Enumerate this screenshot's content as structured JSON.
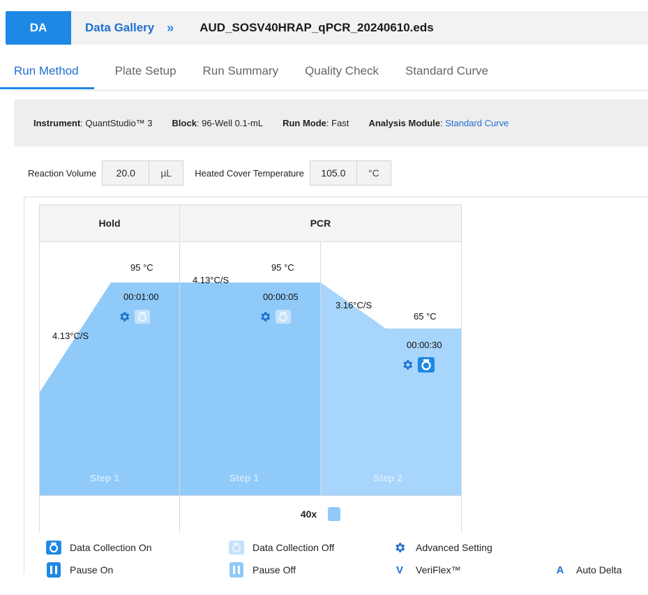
{
  "header": {
    "logo": "DA",
    "breadcrumb_link": "Data Gallery",
    "breadcrumb_sep": "»",
    "file_name": "AUD_SOSV40HRAP_qPCR_20240610.eds"
  },
  "tabs": [
    {
      "label": "Run Method",
      "active": true
    },
    {
      "label": "Plate Setup"
    },
    {
      "label": "Run Summary"
    },
    {
      "label": "Quality Check"
    },
    {
      "label": "Standard Curve"
    }
  ],
  "info": {
    "instrument_label": "Instrument",
    "instrument_value": "QuantStudio™ 3",
    "block_label": "Block",
    "block_value": "96-Well 0.1-mL",
    "run_mode_label": "Run Mode",
    "run_mode_value": "Fast",
    "module_label": "Analysis Module",
    "module_value": "Standard Curve"
  },
  "settings": {
    "reaction_volume_label": "Reaction Volume",
    "reaction_volume_value": "20.0",
    "reaction_volume_unit": "µL",
    "cover_temp_label": "Heated Cover Temperature",
    "cover_temp_value": "105.0",
    "cover_temp_unit": "°C"
  },
  "profile": {
    "stages": [
      {
        "name": "Hold",
        "cycles": "",
        "steps": [
          {
            "label": "Step 1",
            "ramp": "4.13°C/S",
            "temp": "95 °C",
            "time": "00:01:00",
            "data_collection": false
          }
        ]
      },
      {
        "name": "PCR",
        "cycles": "40x",
        "steps": [
          {
            "label": "Step 1",
            "ramp": "4.13°C/S",
            "temp": "95 °C",
            "time": "00:00:05",
            "data_collection": false
          },
          {
            "label": "Step 2",
            "ramp": "3.16°C/S",
            "temp": "65 °C",
            "time": "00:00:30",
            "data_collection": true
          }
        ]
      }
    ]
  },
  "legend": {
    "data_on": "Data Collection On",
    "data_off": "Data Collection Off",
    "advanced": "Advanced Setting",
    "pause_on": "Pause On",
    "pause_off": "Pause Off",
    "veriflex_letter": "V",
    "veriflex": "VeriFlex™",
    "auto_delta_letter": "A",
    "auto_delta": "Auto Delta"
  },
  "colors": {
    "accent": "#1e88e5",
    "profile_fill": "#90caf9",
    "profile_fill_light": "#a7d5fb",
    "camera_off": "#c5e1fb"
  }
}
